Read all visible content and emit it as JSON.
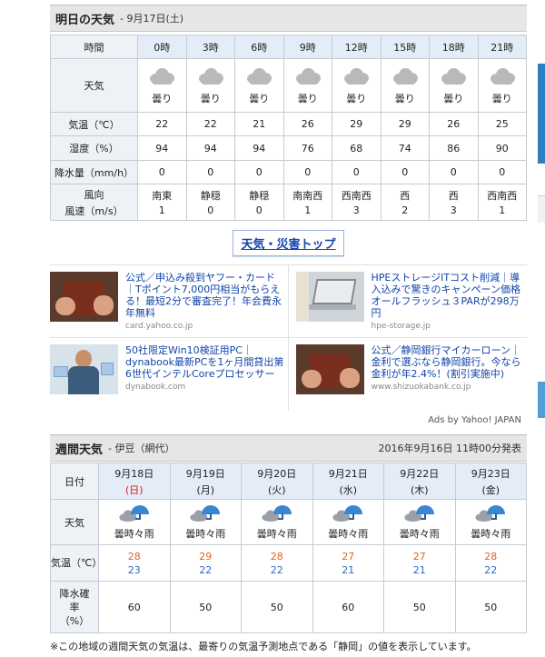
{
  "tomorrow": {
    "title": "明日の天気",
    "date": "- 9月17日(土)",
    "rows": {
      "time_label": "時間",
      "weather_label": "天気",
      "temp_label": "気温（℃）",
      "humidity_label": "湿度（%）",
      "precip_label": "降水量（mm/h）",
      "wind_dir_label": "風向",
      "wind_speed_label": "風速（m/s）"
    },
    "hours": [
      {
        "time": "0時",
        "weather": "曇り",
        "icon": "cloud-icon",
        "temp": "22",
        "humidity": "94",
        "precip": "0",
        "wind_dir": "南東",
        "wind_speed": "1"
      },
      {
        "time": "3時",
        "weather": "曇り",
        "icon": "cloud-icon",
        "temp": "22",
        "humidity": "94",
        "precip": "0",
        "wind_dir": "静穏",
        "wind_speed": "0"
      },
      {
        "time": "6時",
        "weather": "曇り",
        "icon": "cloud-icon",
        "temp": "21",
        "humidity": "94",
        "precip": "0",
        "wind_dir": "静穏",
        "wind_speed": "0"
      },
      {
        "time": "9時",
        "weather": "曇り",
        "icon": "cloud-icon",
        "temp": "26",
        "humidity": "76",
        "precip": "0",
        "wind_dir": "南南西",
        "wind_speed": "1"
      },
      {
        "time": "12時",
        "weather": "曇り",
        "icon": "cloud-icon",
        "temp": "29",
        "humidity": "68",
        "precip": "0",
        "wind_dir": "西南西",
        "wind_speed": "3"
      },
      {
        "time": "15時",
        "weather": "曇り",
        "icon": "cloud-icon",
        "temp": "29",
        "humidity": "74",
        "precip": "0",
        "wind_dir": "西",
        "wind_speed": "2"
      },
      {
        "time": "18時",
        "weather": "曇り",
        "icon": "cloud-icon",
        "temp": "26",
        "humidity": "86",
        "precip": "0",
        "wind_dir": "西",
        "wind_speed": "3"
      },
      {
        "time": "21時",
        "weather": "曇り",
        "icon": "cloud-icon",
        "temp": "25",
        "humidity": "90",
        "precip": "0",
        "wind_dir": "西南西",
        "wind_speed": "1"
      }
    ]
  },
  "disaster_link": "天気・災害トップ",
  "ads": [
    {
      "title": "公式／申込み殺到ヤフー・カード｜Tポイント7,000円相当がもらえる！最短2分で審査完了！年会費永年無料",
      "domain": "card.yahoo.co.jp",
      "image": "wallet-photo"
    },
    {
      "title": "HPEストレージITコスト削減｜導入込みで驚きのキャンペーン価格オールフラッシュ３PARが298万円",
      "domain": "hpe-storage.jp",
      "image": "laptop-photo"
    },
    {
      "title": "50社限定Win10検証用PC｜dynabook最新PCを1ヶ月間貸出第6世代インテルCoreプロセッサー",
      "domain": "dynabook.com",
      "image": "woman-tablet-photo"
    },
    {
      "title": "公式／静岡銀行マイカーローン｜金利で選ぶなら静岡銀行。今なら金利が年2.4%！(割引実施中)",
      "domain": "www.shizuokabank.co.jp",
      "image": "wallet-photo"
    }
  ],
  "ads_by": "Ads by Yahoo! JAPAN",
  "weekly": {
    "title": "週間天気",
    "region": "- 伊豆（網代）",
    "issued": "2016年9月16日 11時00分発表",
    "rows": {
      "date_label": "日付",
      "weather_label": "天気",
      "temp_label": "気温（℃）",
      "pop_label": "降水確率（%）"
    },
    "days": [
      {
        "date": "9月18日",
        "dow": "(日)",
        "weather": "曇時々雨",
        "icon": "cloud-rain-umbrella-icon",
        "high": "28",
        "low": "23",
        "pop": "60"
      },
      {
        "date": "9月19日",
        "dow": "(月)",
        "weather": "曇時々雨",
        "icon": "cloud-rain-umbrella-icon",
        "high": "29",
        "low": "22",
        "pop": "50"
      },
      {
        "date": "9月20日",
        "dow": "(火)",
        "weather": "曇時々雨",
        "icon": "cloud-rain-umbrella-icon",
        "high": "28",
        "low": "22",
        "pop": "50"
      },
      {
        "date": "9月21日",
        "dow": "(水)",
        "weather": "曇時々雨",
        "icon": "cloud-rain-umbrella-icon",
        "high": "27",
        "low": "21",
        "pop": "60"
      },
      {
        "date": "9月22日",
        "dow": "(木)",
        "weather": "曇時々雨",
        "icon": "cloud-rain-umbrella-icon",
        "high": "27",
        "low": "21",
        "pop": "50"
      },
      {
        "date": "9月23日",
        "dow": "(金)",
        "weather": "曇時々雨",
        "icon": "cloud-rain-umbrella-icon",
        "high": "28",
        "low": "22",
        "pop": "50"
      }
    ]
  },
  "footnote": "※この地域の週間天気の気温は、最寄りの気温予測地点である「静岡」の値を表示しています。",
  "colors": {
    "sunday": "#d81b1b",
    "high_temp": "#e0641c",
    "low_temp": "#2a6bc2",
    "link": "#1144aa",
    "umbrella": "#3a86d3"
  }
}
